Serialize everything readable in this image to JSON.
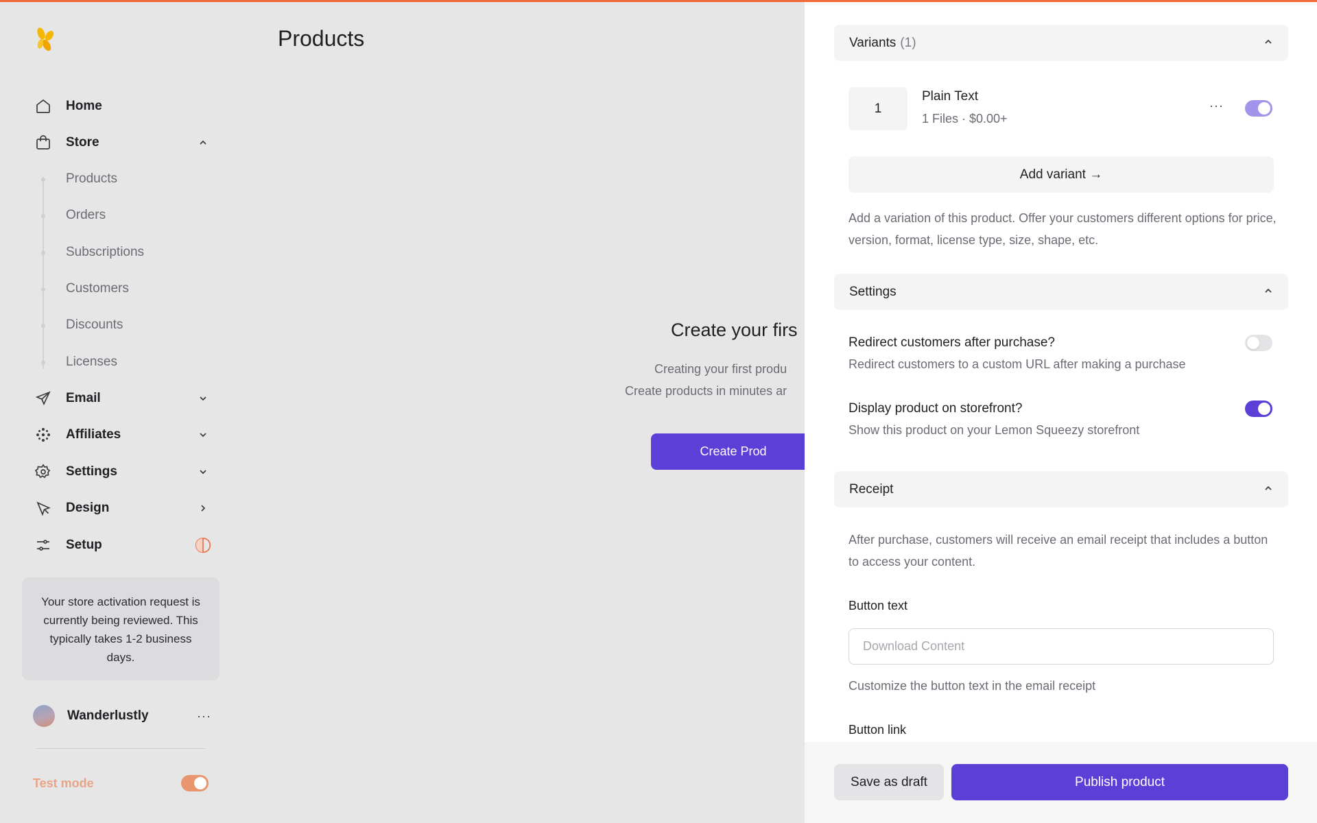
{
  "app": {
    "accent": "#5b3fd6",
    "brand": "#f26b3a",
    "logo": "lemon-squeezy-logo-icon"
  },
  "sidebar": {
    "home": "Home",
    "store": "Store",
    "store_items": [
      "Products",
      "Orders",
      "Subscriptions",
      "Customers",
      "Discounts",
      "Licenses"
    ],
    "email": "Email",
    "affiliates": "Affiliates",
    "settings": "Settings",
    "design": "Design",
    "setup": "Setup",
    "notice": "Your store activation request is currently being reviewed. This typically takes 1-2 business days.",
    "user": {
      "name": "Wanderlustly",
      "menu": "···"
    },
    "test_mode": {
      "label": "Test mode",
      "enabled": true
    }
  },
  "main": {
    "title": "Products",
    "empty_title": "Create your firs",
    "empty_line1": "Creating your first produ",
    "empty_line2": "Create products in minutes ar",
    "create_button": "Create Prod"
  },
  "panel": {
    "variants": {
      "header": "Variants",
      "count": "(1)",
      "items": [
        {
          "number": "1",
          "name": "Plain Text",
          "meta": "1 Files · $0.00+",
          "menu": "···",
          "enabled": true
        }
      ],
      "add_button": "Add variant →",
      "help": "Add a variation of this product. Offer your customers different options for price, version, format, license type, size, shape, etc."
    },
    "settings": {
      "header": "Settings",
      "redirect_title": "Redirect customers after purchase?",
      "redirect_desc": "Redirect customers to a custom URL after making a purchase",
      "redirect_enabled": false,
      "storefront_title": "Display product on storefront?",
      "storefront_desc": "Show this product on your Lemon Squeezy storefront",
      "storefront_enabled": true
    },
    "receipt": {
      "header": "Receipt",
      "help": "After purchase, customers will receive an email receipt that includes a button to access your content.",
      "button_text_label": "Button text",
      "button_text_value": "",
      "button_text_placeholder": "Download Content",
      "button_text_help": "Customize the button text in the email receipt",
      "button_link_label": "Button link"
    },
    "footer": {
      "draft": "Save as draft",
      "publish": "Publish product"
    }
  }
}
